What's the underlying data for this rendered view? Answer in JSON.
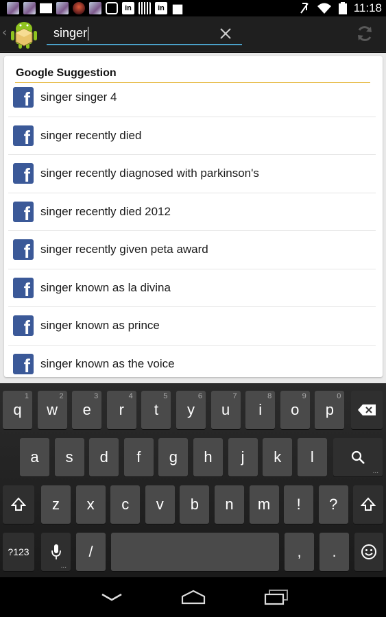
{
  "status_bar": {
    "time": "11:18",
    "left_icons": [
      "photo-notification-icon",
      "photo-notification-icon",
      "mail-icon",
      "photo-notification-icon",
      "app-notification-icon",
      "photo-notification-icon",
      "camera-icon",
      "linkedin-icon",
      "bars-icon",
      "linkedin-icon",
      "bag-icon"
    ],
    "right_icons": [
      "mute-icon",
      "wifi-icon",
      "battery-icon"
    ],
    "linkedin_label": "in"
  },
  "action_bar": {
    "search_value": "singer",
    "app_icon": "android-app-icon",
    "clear_icon": "clear-icon",
    "refresh_icon": "refresh-icon"
  },
  "suggestions": {
    "title": "Google Suggestion",
    "item_icon": "facebook-icon",
    "icon_letter": "f",
    "items": [
      "singer singer 4",
      "singer recently died",
      "singer recently diagnosed with parkinson's",
      "singer recently died 2012",
      "singer recently given peta award",
      "singer known as la divina",
      "singer known as prince",
      "singer known as the voice"
    ]
  },
  "keyboard": {
    "row1": [
      {
        "label": "q",
        "hint": "1"
      },
      {
        "label": "w",
        "hint": "2"
      },
      {
        "label": "e",
        "hint": "3"
      },
      {
        "label": "r",
        "hint": "4"
      },
      {
        "label": "t",
        "hint": "5"
      },
      {
        "label": "y",
        "hint": "6"
      },
      {
        "label": "u",
        "hint": "7"
      },
      {
        "label": "i",
        "hint": "8"
      },
      {
        "label": "o",
        "hint": "9"
      },
      {
        "label": "p",
        "hint": "0"
      }
    ],
    "row2": [
      "a",
      "s",
      "d",
      "f",
      "g",
      "h",
      "j",
      "k",
      "l"
    ],
    "row3": [
      "z",
      "x",
      "c",
      "v",
      "b",
      "n",
      "m",
      "!",
      "?"
    ],
    "symbols_key": "?123",
    "slash_key": "/",
    "comma_key": ",",
    "period_key": ".",
    "delete_icon": "backspace-icon",
    "search_icon": "search-icon",
    "shift_icon": "shift-icon",
    "mic_icon": "microphone-icon",
    "emoji_icon": "emoji-icon",
    "more_dots": "..."
  },
  "nav_bar": {
    "back_icon": "back-icon",
    "home_icon": "home-icon",
    "recents_icon": "recent-apps-icon"
  }
}
